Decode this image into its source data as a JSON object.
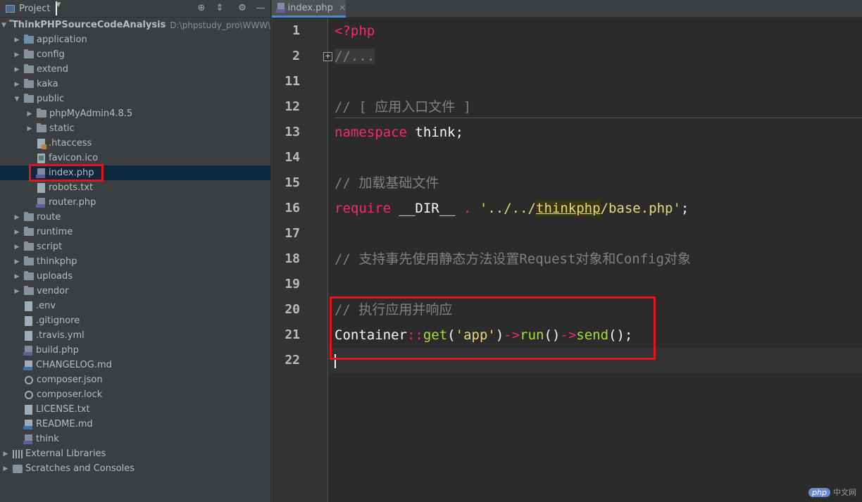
{
  "project_panel": {
    "title": "Project",
    "root": {
      "name": "ThinkPHPSourceCodeAnalysis",
      "path": "D:\\phpstudy_pro\\WWW\\Th"
    },
    "items": [
      {
        "label": "application",
        "type": "folder",
        "color": "blue",
        "depth": 1,
        "expanded": false
      },
      {
        "label": "config",
        "type": "folder",
        "depth": 1,
        "expanded": false
      },
      {
        "label": "extend",
        "type": "folder",
        "depth": 1,
        "expanded": false
      },
      {
        "label": "kaka",
        "type": "folder",
        "depth": 1,
        "expanded": false
      },
      {
        "label": "public",
        "type": "folder",
        "depth": 1,
        "expanded": true
      },
      {
        "label": "phpMyAdmin4.8.5",
        "type": "folder",
        "depth": 2,
        "expanded": false
      },
      {
        "label": "static",
        "type": "folder",
        "depth": 2,
        "expanded": false
      },
      {
        "label": ".htaccess",
        "type": "file",
        "icon": "htaccess-file-icon",
        "depth": 2
      },
      {
        "label": "favicon.ico",
        "type": "file",
        "icon": "image-file-icon",
        "depth": 2
      },
      {
        "label": "index.php",
        "type": "file",
        "icon": "php-file-icon",
        "depth": 2,
        "selected": true
      },
      {
        "label": "robots.txt",
        "type": "file",
        "icon": "text-file-icon",
        "depth": 2
      },
      {
        "label": "router.php",
        "type": "file",
        "icon": "php-file-icon",
        "depth": 2
      },
      {
        "label": "route",
        "type": "folder",
        "depth": 1,
        "expanded": false
      },
      {
        "label": "runtime",
        "type": "folder",
        "depth": 1,
        "expanded": false
      },
      {
        "label": "script",
        "type": "folder",
        "depth": 1,
        "expanded": false
      },
      {
        "label": "thinkphp",
        "type": "folder",
        "depth": 1,
        "expanded": false
      },
      {
        "label": "uploads",
        "type": "folder",
        "depth": 1,
        "expanded": false
      },
      {
        "label": "vendor",
        "type": "folder",
        "depth": 1,
        "expanded": false
      },
      {
        "label": ".env",
        "type": "file",
        "icon": "text-file-icon",
        "depth": 1
      },
      {
        "label": ".gitignore",
        "type": "file",
        "icon": "text-file-icon",
        "depth": 1
      },
      {
        "label": ".travis.yml",
        "type": "file",
        "icon": "yaml-file-icon",
        "depth": 1
      },
      {
        "label": "build.php",
        "type": "file",
        "icon": "php-file-icon",
        "depth": 1
      },
      {
        "label": "CHANGELOG.md",
        "type": "file",
        "icon": "markdown-file-icon",
        "depth": 1
      },
      {
        "label": "composer.json",
        "type": "file",
        "icon": "json-file-icon",
        "depth": 1
      },
      {
        "label": "composer.lock",
        "type": "file",
        "icon": "json-file-icon",
        "depth": 1
      },
      {
        "label": "LICENSE.txt",
        "type": "file",
        "icon": "text-file-icon",
        "depth": 1
      },
      {
        "label": "README.md",
        "type": "file",
        "icon": "markdown-file-icon",
        "depth": 1
      },
      {
        "label": "think",
        "type": "file",
        "icon": "php-file-icon",
        "depth": 1
      }
    ],
    "external_libraries": "External Libraries",
    "scratches": "Scratches and Consoles"
  },
  "editor": {
    "tab_label": "index.php",
    "lines": [
      {
        "num": "1",
        "text": "<?php"
      },
      {
        "num": "2",
        "text": "//..."
      },
      {
        "num": "11",
        "text": ""
      },
      {
        "num": "12",
        "text": "// [ 应用入口文件 ]"
      },
      {
        "num": "13",
        "text": "namespace think;"
      },
      {
        "num": "14",
        "text": ""
      },
      {
        "num": "15",
        "text": "// 加载基础文件"
      },
      {
        "num": "16",
        "text": "require __DIR__ . '../../thinkphp/base.php';"
      },
      {
        "num": "17",
        "text": ""
      },
      {
        "num": "18",
        "text": "// 支持事先使用静态方法设置Request对象和Config对象"
      },
      {
        "num": "19",
        "text": ""
      },
      {
        "num": "20",
        "text": "// 执行应用并响应"
      },
      {
        "num": "21",
        "text": "Container::get('app')->run()->send();"
      },
      {
        "num": "22",
        "text": ""
      }
    ],
    "tokens": {
      "l1": "<?php",
      "l2": "//...",
      "l12": "// [ 应用入口文件 ]",
      "l13_kw": "namespace",
      "l13_rest": " think;",
      "l15": "// 加载基础文件",
      "l16_kw": "require",
      "l16_dir": " __DIR__ ",
      "l16_dot": ".",
      "l16_s1": " '../../",
      "l16_hl": "thinkphp",
      "l16_s2": "/base.php'",
      "l16_end": ";",
      "l18": "// 支持事先使用静态方法设置Request对象和Config对象",
      "l20": "// 执行应用并响应",
      "l21_a": "Container",
      "l21_b": "::",
      "l21_c": "get",
      "l21_d": "(",
      "l21_e": "'app'",
      "l21_f": ")",
      "l21_g": "->",
      "l21_h": "run",
      "l21_i": "()",
      "l21_j": "->",
      "l21_k": "send",
      "l21_l": "();"
    }
  },
  "watermark": {
    "logo": "php",
    "text": "中文网"
  },
  "colors": {
    "highlight_box": "#e3151a",
    "keyword": "#f92672",
    "function": "#a6e22e",
    "string": "#e6db74",
    "comment": "#808080",
    "selection": "#0d293e"
  }
}
